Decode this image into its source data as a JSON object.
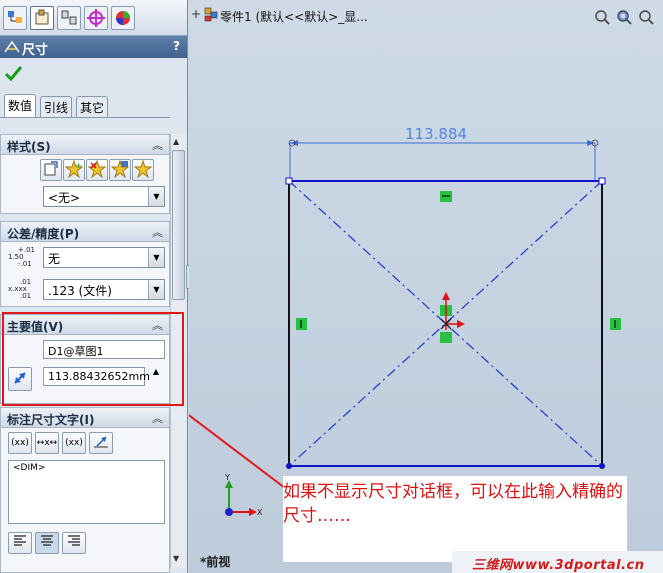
{
  "property_manager": {
    "title": "尺寸",
    "help": "?",
    "tabs": [
      "数值",
      "引线",
      "其它"
    ],
    "style_group": {
      "title": "样式(S)",
      "preset_combo": "<无>"
    },
    "tolerance_group": {
      "title": "公差/精度(P)",
      "tolerance_icon_text": [
        "+.01",
        "1.50",
        "-.01"
      ],
      "tolerance_combo": "无",
      "precision_icon_text": [
        ".01",
        "x.xxx",
        ".01"
      ],
      "precision_combo": ".123 (文件)"
    },
    "primary_value_group": {
      "title": "主要值(V)",
      "name_field": "D1@草图1",
      "value_field": "113.88432652mm"
    },
    "dim_text_group": {
      "title": "标注尺寸文字(I)",
      "buttons": [
        "(xx)",
        "↔x↔",
        "(xx)"
      ],
      "text_value": "<DIM>"
    }
  },
  "graphics": {
    "title": "零件1 (默认<<默认>_显...",
    "dimension_text": "113.884",
    "view_label": "*前视",
    "axis_x": "X",
    "axis_y": "Y",
    "sketch_color": "#0000cc",
    "dimension_color": "#3a6fd8",
    "relation_color": "#28c040"
  },
  "annotation": {
    "note_text": "如果不显示尺寸对话框，可以在此输入精确的尺寸……",
    "note_color": "#e01010",
    "watermark": "三维网www.3dportal.cn"
  }
}
